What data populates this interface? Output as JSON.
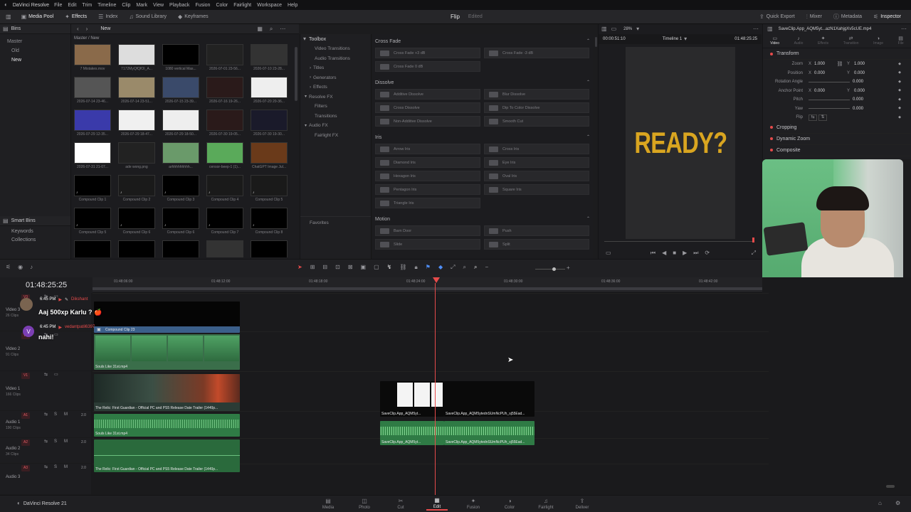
{
  "app": {
    "title": "DaVinci Resolve",
    "footer_name": "DaVinci Resolve 21"
  },
  "menu": [
    "File",
    "Edit",
    "Trim",
    "Timeline",
    "Clip",
    "Mark",
    "View",
    "Playback",
    "Fusion",
    "Color",
    "Fairlight",
    "Workspace",
    "Help"
  ],
  "toolbar": {
    "left": [
      {
        "label": "Media Pool",
        "icon": "media-pool-icon"
      },
      {
        "label": "Effects",
        "icon": "effects-icon"
      },
      {
        "label": "Index",
        "icon": "index-icon"
      },
      {
        "label": "Sound Library",
        "icon": "sound-library-icon"
      },
      {
        "label": "Keyframes",
        "icon": "keyframes-icon"
      }
    ],
    "project_name": "Flip",
    "project_status": "Edited",
    "right": [
      {
        "label": "Quick Export",
        "icon": "export-icon"
      },
      {
        "label": "Mixer",
        "icon": "mixer-icon"
      },
      {
        "label": "Metadata",
        "icon": "metadata-icon"
      },
      {
        "label": "Inspector",
        "icon": "inspector-icon"
      }
    ]
  },
  "bins": {
    "header": "Bins",
    "items": [
      {
        "label": "Master"
      },
      {
        "label": "Old"
      },
      {
        "label": "New"
      }
    ],
    "smart_header": "Smart Bins",
    "smart_items": [
      {
        "label": "Keywords"
      },
      {
        "label": "Collections"
      }
    ]
  },
  "media_pool": {
    "breadcrumb": "Master / New",
    "current_bin": "New",
    "thumbs": [
      {
        "label": "7 Mistakes.mov",
        "tone": "#8a6a4a"
      },
      {
        "label": "7172MyQfQfOI_A...",
        "tone": "#ddd"
      },
      {
        "label": "1080 vertical Mas...",
        "tone": "#000"
      },
      {
        "label": "2026-07-01 23-56...",
        "tone": "#222"
      },
      {
        "label": "2026-07-10 23-28...",
        "tone": "#333"
      },
      {
        "label": "2026-07-14 23-46...",
        "tone": "#555"
      },
      {
        "label": "2026-07-14 23-51...",
        "tone": "#9a8a6a"
      },
      {
        "label": "2026-07-15 23-39...",
        "tone": "#3a4a6a"
      },
      {
        "label": "2026-07-16 19-26...",
        "tone": "#2a1a1a"
      },
      {
        "label": "2026-07-20 20-36...",
        "tone": "#eee"
      },
      {
        "label": "2026-07-29 12-35...",
        "tone": "#3a3aaa"
      },
      {
        "label": "2026-07-29 18-47...",
        "tone": "#f0f0f0"
      },
      {
        "label": "2026-07-29 18-50...",
        "tone": "#eee"
      },
      {
        "label": "2026-07-30 19-05...",
        "tone": "#2a1a1a"
      },
      {
        "label": "2026-07-30 19-30...",
        "tone": "#1a1a2a"
      },
      {
        "label": "2026-07-31 21-07...",
        "tone": "#fff"
      },
      {
        "label": "ade wong.png",
        "tone": "#222"
      },
      {
        "label": "arhhhhhhhhh...",
        "tone": "#6a9a6a"
      },
      {
        "label": "censor-beep-1 (1)...",
        "tone": "#5aaa5a"
      },
      {
        "label": "ChatGPT Image Jul...",
        "tone": "#6a3a1a"
      },
      {
        "label": "Compound Clip 1",
        "tone": "#000"
      },
      {
        "label": "Compound Clip 2",
        "tone": "#1a1a1a"
      },
      {
        "label": "Compound Clip 3",
        "tone": "#000"
      },
      {
        "label": "Compound Clip 4",
        "tone": "#1a1a1a"
      },
      {
        "label": "Compound Clip 5",
        "tone": "#1a1a1a"
      },
      {
        "label": "Compound Clip 5",
        "tone": "#000"
      },
      {
        "label": "Compound Clip 6",
        "tone": "#000"
      },
      {
        "label": "Compound Clip 6",
        "tone": "#000"
      },
      {
        "label": "Compound Clip 7",
        "tone": "#000"
      },
      {
        "label": "Compound Clip 8",
        "tone": "#000"
      },
      {
        "label": "",
        "tone": "#000"
      },
      {
        "label": "",
        "tone": "#000"
      },
      {
        "label": "",
        "tone": "#000"
      },
      {
        "label": "",
        "tone": "#333"
      },
      {
        "label": "",
        "tone": "#000"
      }
    ]
  },
  "toolbox": {
    "header": "Toolbox",
    "items": [
      {
        "label": "Video Transitions",
        "indent": 2
      },
      {
        "label": "Audio Transitions",
        "indent": 2
      },
      {
        "label": "Titles",
        "indent": 1
      },
      {
        "label": "Generators",
        "indent": 1
      },
      {
        "label": "Effects",
        "indent": 1
      },
      {
        "label": "Resolve FX",
        "indent": 0
      },
      {
        "label": "Filters",
        "indent": 2
      },
      {
        "label": "Transitions",
        "indent": 2
      },
      {
        "label": "Audio FX",
        "indent": 0
      },
      {
        "label": "Fairlight FX",
        "indent": 2
      }
    ],
    "favorites": "Favorites"
  },
  "effects": {
    "groups": [
      {
        "title": "Cross Fade",
        "items": [
          "Cross Fade +3 dB",
          "Cross Fade -3 dB",
          "Cross Fade 0 dB"
        ]
      },
      {
        "title": "Dissolve",
        "items": [
          "Additive Dissolve",
          "Blur Dissolve",
          "Cross Dissolve",
          "Dip To Color Dissolve",
          "Non-Additive Dissolve",
          "Smooth Cut"
        ]
      },
      {
        "title": "Iris",
        "items": [
          "Arrow Iris",
          "Cross Iris",
          "Diamond Iris",
          "Eye Iris",
          "Hexagon Iris",
          "Oval Iris",
          "Pentagon Iris",
          "Square Iris",
          "Triangle Iris"
        ]
      },
      {
        "title": "Motion",
        "items": [
          "Barn Door",
          "Push",
          "Slide",
          "Split"
        ]
      }
    ]
  },
  "viewer": {
    "timecode_left": "00:00:51:10",
    "zoom": "28%",
    "timeline_name": "Timeline 1",
    "timecode_right": "01:48:25:25",
    "overlay_text": "READY?",
    "overlay_color": "#d9a520"
  },
  "inspector": {
    "clip_name": "SaveClip.App_AQM5yt...azN1XahjgXv5cUE.mp4",
    "tabs": [
      "Video",
      "Audio",
      "Effects",
      "Transition",
      "Image",
      "File"
    ],
    "transform_title": "Transform",
    "rows": [
      {
        "label": "Zoom",
        "x": "1.000",
        "y": "1.000"
      },
      {
        "label": "Position",
        "x": "0.000",
        "y": "0.000"
      },
      {
        "label": "Rotation Angle",
        "v": "0.000"
      },
      {
        "label": "Anchor Point",
        "x": "0.000",
        "y": "0.000"
      },
      {
        "label": "Pitch",
        "v": "0.000"
      },
      {
        "label": "Yaw",
        "v": "0.000"
      },
      {
        "label": "Flip",
        "v": ""
      }
    ],
    "sections": [
      "Cropping",
      "Dynamic Zoom",
      "Composite"
    ]
  },
  "timeline": {
    "timecode": "01:48:25:25",
    "ruler": [
      "01:48:06:00",
      "01:48:12:00",
      "01:48:18:00",
      "01:48:24:00",
      "01:48:30:00",
      "01:48:36:00",
      "01:48:42:00"
    ],
    "tracks": [
      {
        "id": "V3",
        "name": "Video 3",
        "clips": "26 Clips"
      },
      {
        "id": "V2",
        "name": "Video 2",
        "clips": "91 Clips"
      },
      {
        "id": "V1",
        "name": "Video 1",
        "clips": "166 Clips"
      },
      {
        "id": "A1",
        "name": "Audio 1",
        "clips": "190 Clips",
        "vol": "2.0"
      },
      {
        "id": "A2",
        "name": "Audio 2",
        "clips": "34 Clips",
        "vol": "2.0"
      },
      {
        "id": "A3",
        "name": "Audio 3",
        "clips": "",
        "vol": "2.0"
      }
    ],
    "clips": {
      "v3_label": "Compound Clip 23",
      "v2_label": "Souls Like 31st.mp4",
      "v1_label": "The Relic: First Guardian - Official PC and PS5 Release Date Trailer (1440p...",
      "a1_label": "Souls Like 31st.mp4",
      "a2_label": "The Relic: First Guardian - Official PC and PS5 Release Date Trailer (1440p...",
      "save1": "SaveClip.App_AQM5yt...",
      "save2": "SaveClip.App_AQM5ytednSUmNcPUh_sj55Ead...",
      "save1a": "SaveClip.App_AQM5yt...",
      "save2a": "SaveClip.App_AQM5ytednSUmNcPUh_sj55Ead..."
    }
  },
  "chat": {
    "messages": [
      {
        "time": "6:45 PM",
        "user": "Dikshant",
        "text": "Aaj 500xp Karlu ? 🍎"
      },
      {
        "time": "6:45 PM",
        "user": "vedantpatil6397",
        "text": "nahi!"
      }
    ]
  },
  "pages": [
    {
      "label": "Media",
      "icon": "media-page-icon"
    },
    {
      "label": "Photo",
      "icon": "photo-page-icon"
    },
    {
      "label": "Cut",
      "icon": "cut-page-icon"
    },
    {
      "label": "Edit",
      "icon": "edit-page-icon"
    },
    {
      "label": "Fusion",
      "icon": "fusion-page-icon"
    },
    {
      "label": "Color",
      "icon": "color-page-icon"
    },
    {
      "label": "Fairlight",
      "icon": "fairlight-page-icon"
    },
    {
      "label": "Deliver",
      "icon": "deliver-page-icon"
    }
  ],
  "active_page": "Edit",
  "accent": "#e64b4b"
}
